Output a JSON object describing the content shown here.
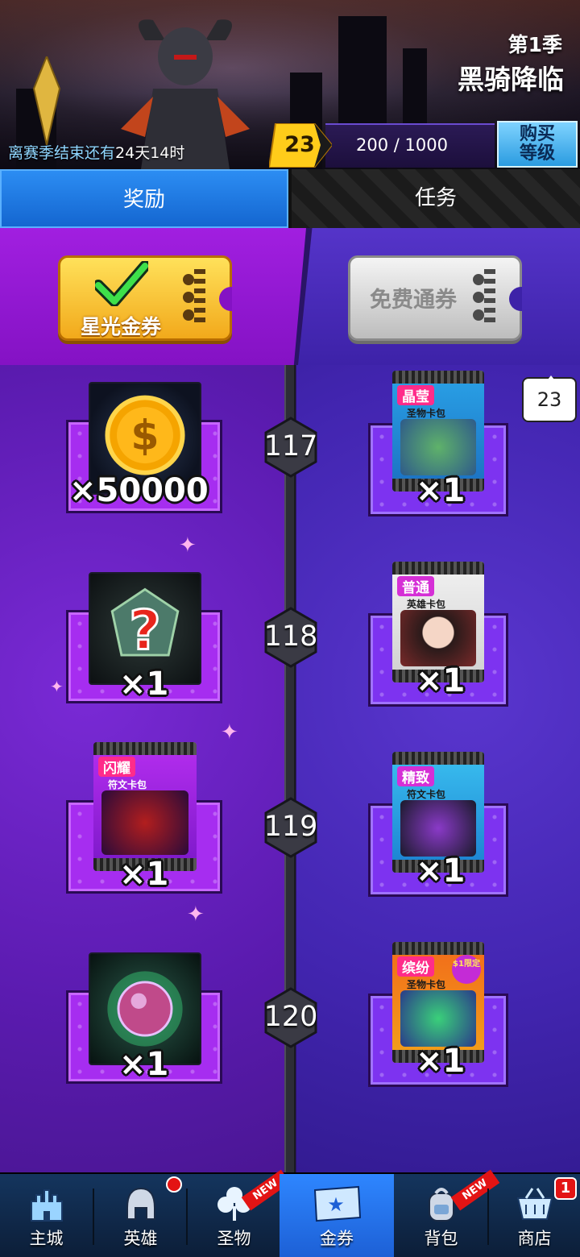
{
  "season": {
    "number_label": "第1季",
    "name": "黑骑降临",
    "countdown_label": "离赛季结束还有",
    "countdown_value": "24天14时"
  },
  "progress": {
    "level": "23",
    "xp_text": "200 / 1000",
    "xp_fraction": 0,
    "buy_level_label_1": "购买",
    "buy_level_label_2": "等级"
  },
  "tabs": {
    "rewards": "奖励",
    "quests": "任务"
  },
  "passes": {
    "gold_label": "星光金券",
    "free_label": "免费通券"
  },
  "current_level_bubble": "23",
  "reward_rows": [
    {
      "level": "117",
      "gold": {
        "item": "gold-coins",
        "qty": "×50000"
      },
      "free": {
        "item": "card-pack",
        "pack_title": "晶莹",
        "pack_sub": "圣物卡包",
        "qty": "×1"
      }
    },
    {
      "level": "118",
      "gold": {
        "item": "mystery-relic",
        "qty": "×1"
      },
      "free": {
        "item": "card-pack",
        "pack_title": "普通",
        "pack_sub": "英雄卡包",
        "qty": "×1"
      }
    },
    {
      "level": "119",
      "gold": {
        "item": "card-pack",
        "pack_title": "闪耀",
        "pack_sub": "符文卡包",
        "qty": "×1"
      },
      "free": {
        "item": "card-pack",
        "pack_title": "精致",
        "pack_sub": "符文卡包",
        "qty": "×1"
      }
    },
    {
      "level": "120",
      "gold": {
        "item": "relic-orb",
        "qty": "×1"
      },
      "free": {
        "item": "card-pack",
        "pack_title": "缤纷",
        "pack_sub": "圣物卡包",
        "pack_tag": "$1限定",
        "qty": "×1"
      }
    }
  ],
  "nav": [
    {
      "label": "主城",
      "icon": "castle-icon"
    },
    {
      "label": "英雄",
      "icon": "helmet-icon"
    },
    {
      "label": "圣物",
      "icon": "clover-icon",
      "tag": "NEW"
    },
    {
      "label": "金券",
      "icon": "ticket-icon",
      "active": true
    },
    {
      "label": "背包",
      "icon": "backpack-icon",
      "tag": "NEW"
    },
    {
      "label": "商店",
      "icon": "basket-icon",
      "badge": "1"
    }
  ],
  "colors": {
    "gold_lane": "#5b1bb0",
    "free_lane": "#4225b0",
    "active_tab": "#1466d0",
    "gold_ticket": "#f2a91b"
  }
}
